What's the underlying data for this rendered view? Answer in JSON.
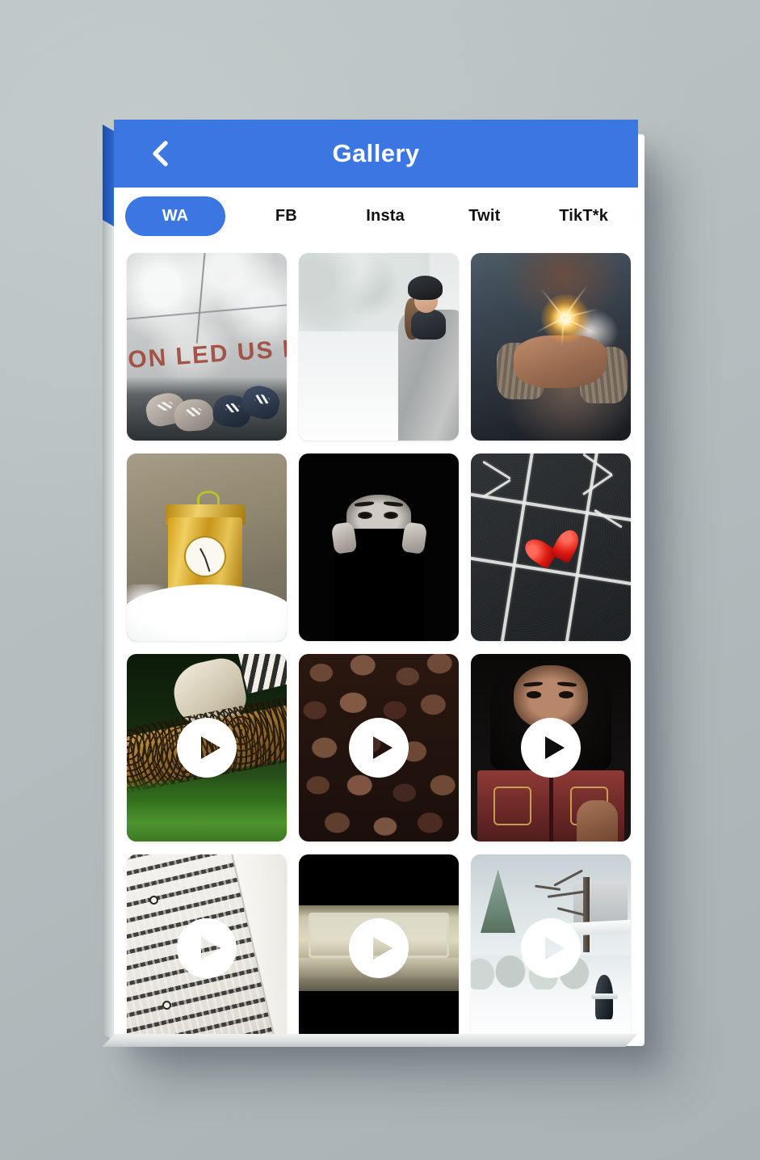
{
  "app": {
    "title": "Gallery",
    "accent_color": "#3b76e3",
    "header_text_color": "#ffffff",
    "screen_background": "#ffffff",
    "page_background": "#b6bfc0"
  },
  "header": {
    "back_icon": "chevron-left-icon",
    "title": "Gallery"
  },
  "tabs": [
    {
      "label": "WA",
      "active": true
    },
    {
      "label": "FB",
      "active": false
    },
    {
      "label": "Insta",
      "active": false
    },
    {
      "label": "Twit",
      "active": false
    },
    {
      "label": "TikT*k",
      "active": false
    }
  ],
  "gallery": {
    "columns": 3,
    "items": [
      {
        "type": "photo",
        "description": "Overhead view of four feet in shoes on concrete pavement with red painted text",
        "overlay_text": "ION LED US H",
        "is_video": false
      },
      {
        "type": "photo",
        "description": "Woman in grey coat and fur hat standing on snowy forest path",
        "is_video": false
      },
      {
        "type": "photo",
        "description": "Hands in fingerless gloves holding a burning sparkler",
        "is_video": false
      },
      {
        "type": "photo",
        "description": "Golden ornamental mantel clock resting on artificial snow",
        "is_video": false
      },
      {
        "type": "photo",
        "description": "Black and white portrait of a woman covering her face with black cloth",
        "is_video": false
      },
      {
        "type": "photo",
        "description": "Red heart candy on a chalk tic-tac-toe board drawn on blackboard",
        "is_video": false
      },
      {
        "type": "video",
        "description": "Beekeeper in white glove lifting a honeycomb frame covered in bees over grass",
        "is_video": true
      },
      {
        "type": "video",
        "description": "Close-up of roasted dark coffee beans",
        "is_video": true
      },
      {
        "type": "video",
        "description": "Woman in black hijab reading an ornate red Quran in dim light",
        "is_video": true
      },
      {
        "type": "video",
        "description": "Close-up of an open Quran page with Arabic calligraphy",
        "is_video": true
      },
      {
        "type": "video",
        "description": "Letterboxed clip of a long glass container on a wooden ledge",
        "is_video": true
      },
      {
        "type": "video",
        "description": "Snow covered yard with bare tree, bushes and a fire hydrant",
        "is_video": true
      }
    ],
    "play_icon": "play-icon"
  }
}
